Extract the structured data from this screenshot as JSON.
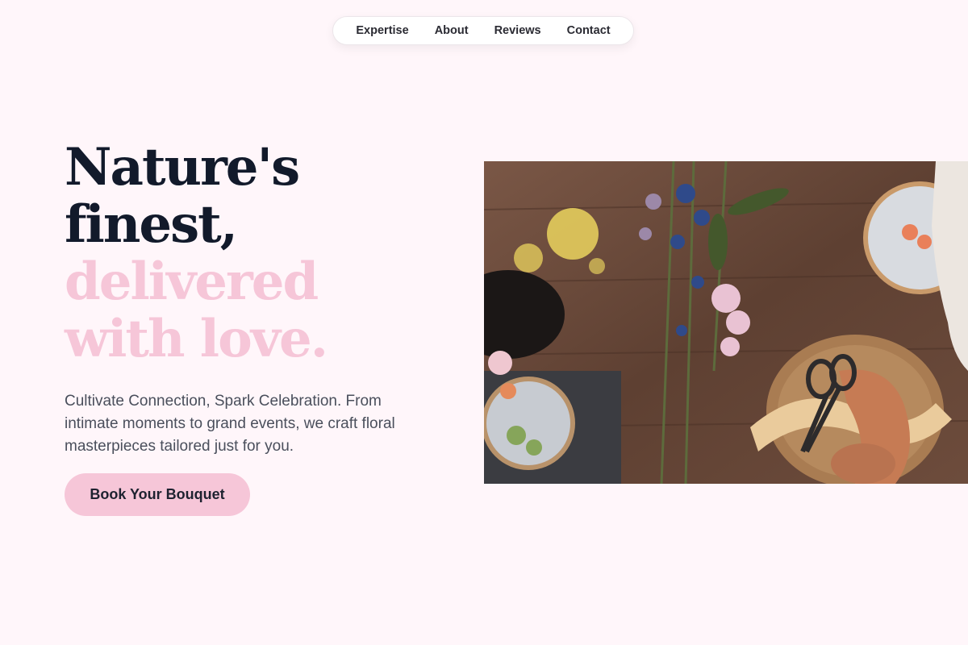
{
  "nav": {
    "items": [
      {
        "label": "Expertise"
      },
      {
        "label": "About"
      },
      {
        "label": "Reviews"
      },
      {
        "label": "Contact"
      }
    ]
  },
  "hero": {
    "title_lines": [
      "Nature's",
      "finest,"
    ],
    "accent_lines": [
      "delivered",
      "with love."
    ],
    "subtitle": "Cultivate Connection, Spark Celebration. From intimate moments to grand events, we craft floral masterpieces tailored just for you.",
    "cta_label": "Book Your Bouquet"
  },
  "colors": {
    "background": "#fff6fa",
    "accent_pink": "#f6c6d8",
    "heading_dark": "#121a2b",
    "body_text": "#4a4f5c"
  }
}
